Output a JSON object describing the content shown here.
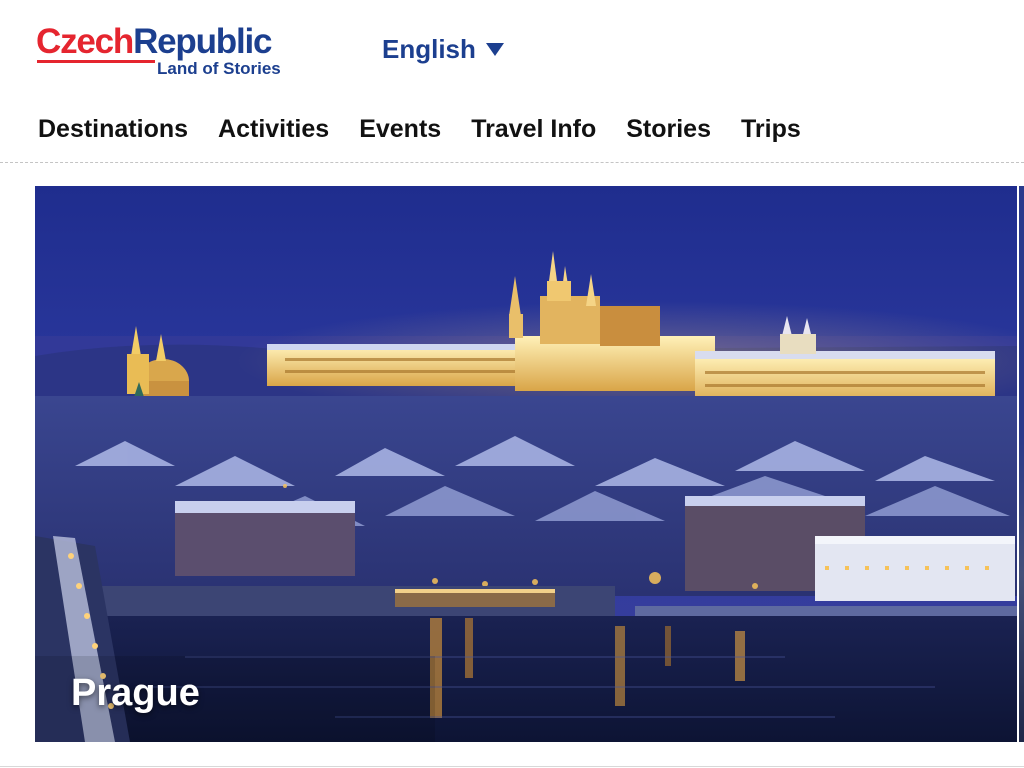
{
  "header": {
    "logo": {
      "word1": "Czech",
      "word2": "Republic",
      "tagline": "Land of Stories"
    },
    "language": {
      "selected": "English"
    }
  },
  "nav": {
    "items": [
      {
        "label": "Destinations"
      },
      {
        "label": "Activities"
      },
      {
        "label": "Events"
      },
      {
        "label": "Travel Info"
      },
      {
        "label": "Stories"
      },
      {
        "label": "Trips"
      }
    ]
  },
  "hero": {
    "caption": "Prague"
  },
  "colors": {
    "brand_red": "#e5252f",
    "brand_blue": "#1c3f8f"
  },
  "icons": {
    "language_dropdown": "chevron-down-icon"
  }
}
